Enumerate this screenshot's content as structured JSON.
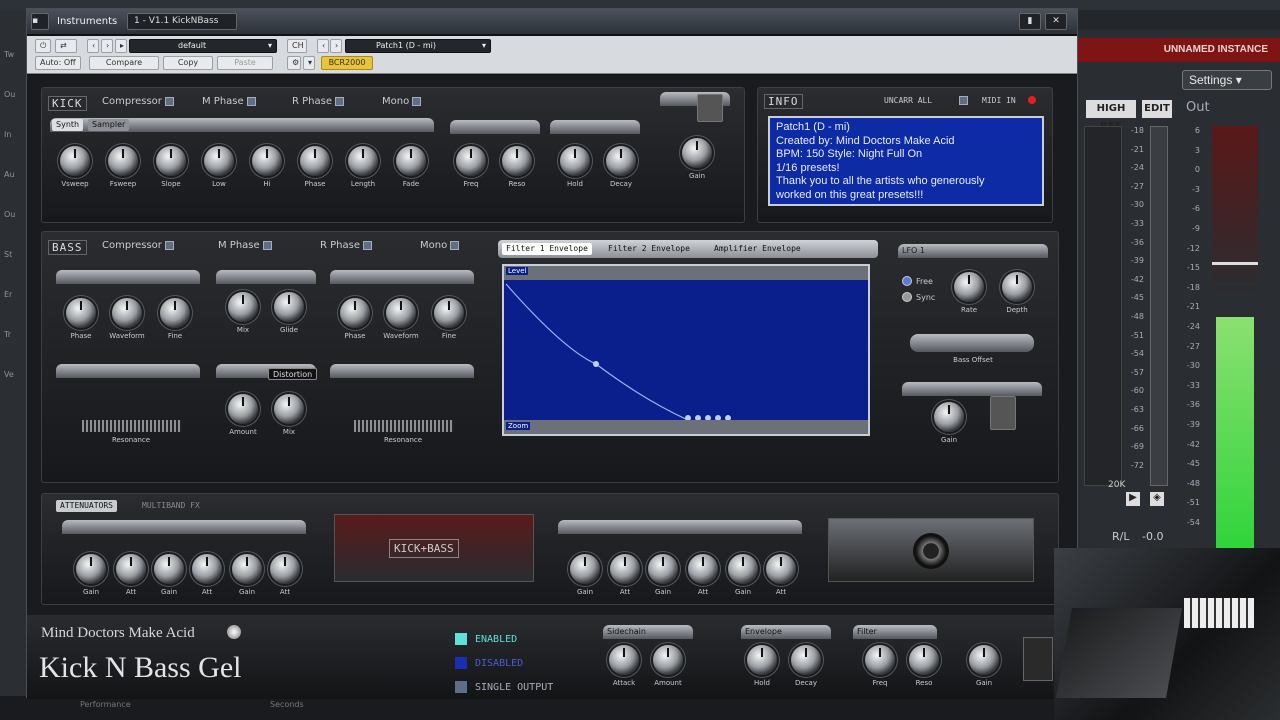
{
  "host": {
    "left_labels": [
      "Tw",
      "Ou",
      "In",
      "Au",
      "Ou",
      "St",
      "Er",
      "Tr",
      "Ve"
    ],
    "bottom_labels": [
      "Performance",
      "Seconds"
    ]
  },
  "window": {
    "tab_title": "Instruments",
    "instance_title": "1 - V1.1 KickNBass",
    "toolbar": {
      "preset_dropdown": "default",
      "auto_off": "Auto: Off",
      "compare": "Compare",
      "copy": "Copy",
      "paste": "Paste",
      "ch_label": "CH",
      "patch_dropdown": "Patch1 (D - mi)",
      "controller": "BCR2000"
    }
  },
  "kick": {
    "title": "KICK",
    "toggles": [
      "Compressor",
      "M Phase",
      "R Phase",
      "Mono"
    ],
    "tabs": [
      "Synth",
      "Sampler"
    ],
    "knobs": [
      "Vsweep",
      "Fsweep",
      "Slope",
      "Low",
      "Hi",
      "Phase",
      "Length",
      "Fade"
    ],
    "filter_knobs": [
      "Freq",
      "Reso"
    ],
    "envelope_knobs": [
      "Hold",
      "Decay"
    ],
    "gain": "Gain"
  },
  "info": {
    "title": "INFO",
    "uncarr": "UNCARR ALL",
    "midi": "MIDI IN",
    "lines": [
      "Patch1 (D - mi)",
      "Created by: Mind Doctors Make Acid",
      "BPM: 150   Style: Night Full On",
      "1/16 presets!",
      "Thank you to all the artists who generously",
      "worked on this great presets!!!"
    ]
  },
  "bass": {
    "title": "BASS",
    "toggles": [
      "Compressor",
      "M Phase",
      "R Phase",
      "Mono"
    ],
    "osc1_knobs": [
      "Phase",
      "Waveform",
      "Fine"
    ],
    "mix_knobs": [
      "Mix",
      "Glide"
    ],
    "osc2_knobs": [
      "Phase",
      "Waveform",
      "Fine"
    ],
    "filter1_label": "Resonance",
    "dist_knobs": [
      "Amount",
      "Mix"
    ],
    "dist_type": "Distortion",
    "filter2_label": "Resonance",
    "env_tabs": [
      "Filter 1 Envelope",
      "Filter 2 Envelope",
      "Amplifier Envelope"
    ],
    "env_top_label": "Level",
    "env_bottom_label": "Zoom",
    "lfo_label": "LFO 1",
    "lfo_modes": [
      "Free",
      "Sync"
    ],
    "lfo_knobs": [
      "Rate",
      "Depth"
    ],
    "bass_offset": "Bass Offset",
    "gain": "Gain"
  },
  "fx": {
    "tabs": [
      "ATTENUATORS",
      "MULTIBAND FX"
    ],
    "left_knobs": [
      "Gain",
      "Att",
      "Gain",
      "Att",
      "Gain",
      "Att"
    ],
    "right_knobs": [
      "Gain",
      "Att",
      "Gain",
      "Att",
      "Gain",
      "Att"
    ],
    "center_logo": "KICK+BASS"
  },
  "footer": {
    "brand": "Mind Doctors Make Acid",
    "product": "Kick N Bass Gel",
    "status": [
      "ENABLED",
      "DISABLED",
      "SINGLE OUTPUT"
    ],
    "knobs": [
      "Attack",
      "Amount",
      "Hold",
      "Decay",
      "Freq",
      "Reso",
      "Gain"
    ],
    "section_labels": [
      "Sidechain",
      "Envelope",
      "Filter"
    ]
  },
  "rightpanel": {
    "instance": "UNNAMED INSTANCE",
    "settings": "Settings",
    "high_res": "HIGH RES",
    "edit": "EDIT",
    "out": "Out",
    "left_scale": [
      "-18",
      "-21",
      "-24",
      "-27",
      "-30",
      "-33",
      "-36",
      "-39",
      "-42",
      "-45",
      "-48",
      "-51",
      "-54",
      "-57",
      "-60",
      "-63",
      "-66",
      "-69",
      "-72"
    ],
    "right_scale": [
      "6",
      "3",
      "0",
      "-3",
      "-6",
      "-9",
      "-12",
      "-15",
      "-18",
      "-21",
      "-24",
      "-27",
      "-30",
      "-33",
      "-36",
      "-39",
      "-42",
      "-45",
      "-48",
      "-51",
      "-54"
    ],
    "bottom_left": "20K",
    "pan": "R/L",
    "db": "-0.0",
    "level_fraction": 0.55,
    "accent": "#7e1414",
    "meter_color": "#2fd43a"
  }
}
